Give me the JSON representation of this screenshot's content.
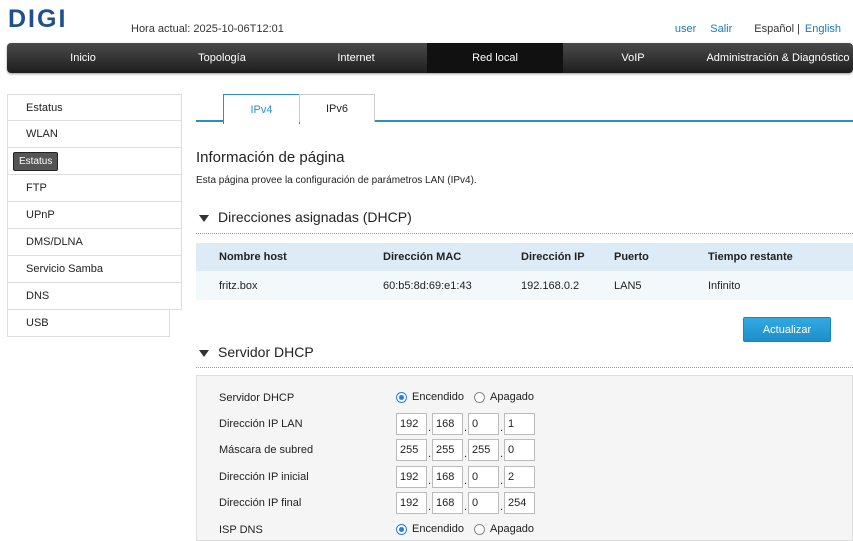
{
  "header": {
    "brand": "DIGI",
    "hora_label": "Hora actual: 2025-10-06T12:01",
    "user_link": "user",
    "logout_link": "Salir",
    "lang_es": "Español",
    "lang_sep": "|",
    "lang_en": "English"
  },
  "nav": {
    "items": [
      "Inicio",
      "Topología",
      "Internet",
      "Red local",
      "VoIP",
      "Administración & Diagnóstico"
    ],
    "active": "Red local"
  },
  "sidebar": {
    "items": [
      "Estatus",
      "WLAN",
      "Estatus",
      "FTP",
      "UPnP",
      "DMS/DLNA",
      "Servicio Samba",
      "DNS",
      "USB"
    ]
  },
  "tabs": [
    "IPv4",
    "IPv6"
  ],
  "page": {
    "title": "Información de página",
    "description": "Esta página provee la configuración de parámetros LAN (IPv4)."
  },
  "dhcp_assigned": {
    "title": "Direcciones asignadas (DHCP)",
    "headers": [
      "Nombre host",
      "Dirección MAC",
      "Dirección IP",
      "Puerto",
      "Tiempo restante"
    ],
    "rows": [
      [
        "fritz.box",
        "60:b5:8d:69:e1:43",
        "192.168.0.2",
        "LAN5",
        "Infinito"
      ]
    ],
    "refresh_button": "Actualizar"
  },
  "dhcp_server": {
    "title": "Servidor DHCP",
    "labels": {
      "server": "Servidor DHCP",
      "lan_ip": "Dirección IP LAN",
      "mask": "Máscara de subred",
      "start_ip": "Dirección IP inicial",
      "end_ip": "Dirección IP final",
      "isp_dns": "ISP DNS"
    },
    "on_label": "Encendido",
    "off_label": "Apagado",
    "lan_ip": [
      "192",
      "168",
      "0",
      "1"
    ],
    "mask": [
      "255",
      "255",
      "255",
      "0"
    ],
    "start_ip": [
      "192",
      "168",
      "0",
      "2"
    ],
    "end_ip": [
      "192",
      "168",
      "0",
      "254"
    ],
    "server_enabled": true,
    "isp_dns_enabled": true
  },
  "colors": {
    "accent": "#2a8fc7",
    "brand": "#1d4f91",
    "button": "#1b8fc9"
  }
}
